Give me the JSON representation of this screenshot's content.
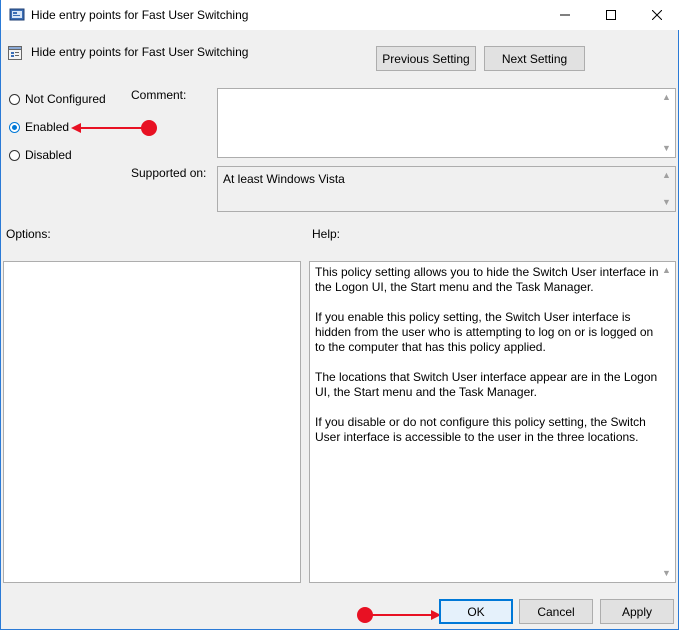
{
  "window": {
    "title": "Hide entry points for Fast User Switching"
  },
  "header": {
    "policy_name": "Hide entry points for Fast User Switching",
    "previous_label": "Previous Setting",
    "next_label": "Next Setting"
  },
  "state": {
    "options": [
      "Not Configured",
      "Enabled",
      "Disabled"
    ],
    "selected": "Enabled"
  },
  "labels": {
    "comment": "Comment:",
    "supported_on": "Supported on:",
    "options": "Options:",
    "help": "Help:"
  },
  "supported_on_value": "At least Windows Vista",
  "comment_value": "",
  "help_paragraphs": [
    "This policy setting allows you to hide the Switch User interface in the Logon UI, the Start menu and the Task Manager.",
    "If you enable this policy setting, the Switch User interface is hidden from the user who is attempting to log on or is logged on to the computer that has this policy applied.",
    "The locations that Switch User interface appear are in the Logon UI, the Start menu and the Task Manager.",
    "If you disable or do not configure this policy setting, the Switch User interface is accessible to the user in the three locations."
  ],
  "footer": {
    "ok_label": "OK",
    "cancel_label": "Cancel",
    "apply_label": "Apply"
  },
  "colors": {
    "accent": "#0078d7",
    "annotation": "#e81123"
  }
}
